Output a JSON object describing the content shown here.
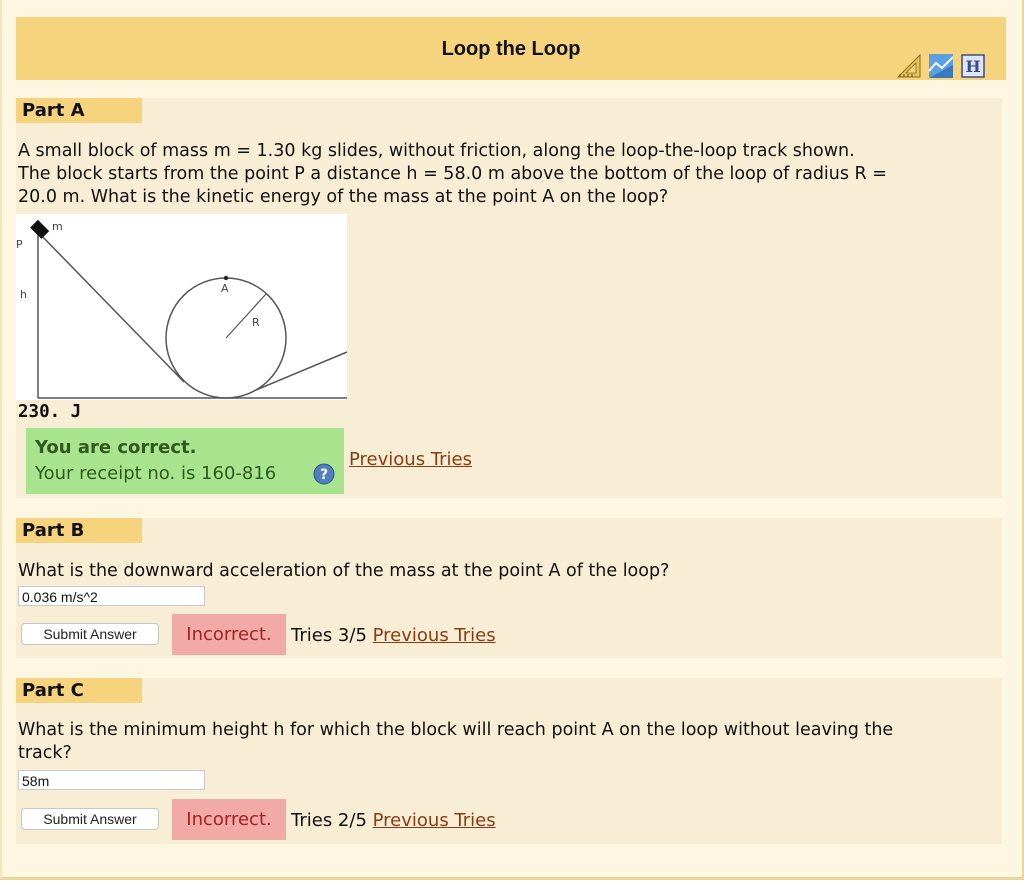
{
  "header": {
    "title": "Loop the Loop",
    "icons": [
      "triangle-ruler-icon",
      "graph-paper-icon",
      "hint-h-icon"
    ]
  },
  "partA": {
    "label": "Part A",
    "q_line1": "A small block of mass m = 1.30 kg slides, without friction, along the loop-the-loop track shown.",
    "q_line2": "The block starts from the point P a distance h = 58.0 m above the bottom of the loop of radius R =",
    "q_line3": "20.0 m. What is the kinetic energy of the mass at the point A on the loop?",
    "figure_labels": {
      "m": "m",
      "P": "P",
      "h": "h",
      "A": "A",
      "R": "R"
    },
    "answer": "230. J",
    "correct_title": "You are correct.",
    "receipt": "Your receipt no. is 160-816",
    "previous_tries": "Previous Tries"
  },
  "partB": {
    "label": "Part B",
    "question": "What is the downward acceleration of the mass at the point A of the loop?",
    "input_value": "0.036 m/s^2",
    "submit": "Submit Answer",
    "status": "Incorrect.",
    "tries": "Tries 3/5",
    "previous_tries": "Previous Tries"
  },
  "partC": {
    "label": "Part C",
    "q_line1": "What is the minimum height h for which the block will reach point A on the loop without leaving the",
    "q_line2": "track?",
    "input_value": "58m",
    "submit": "Submit Answer",
    "status": "Incorrect.",
    "tries": "Tries 2/5",
    "previous_tries": "Previous Tries"
  },
  "colors": {
    "title_bar": "#f6d47e",
    "part_bg": "#f8eed6",
    "correct": "#a8e48e",
    "incorrect": "#f2aaa7",
    "link": "#8a3b12"
  }
}
